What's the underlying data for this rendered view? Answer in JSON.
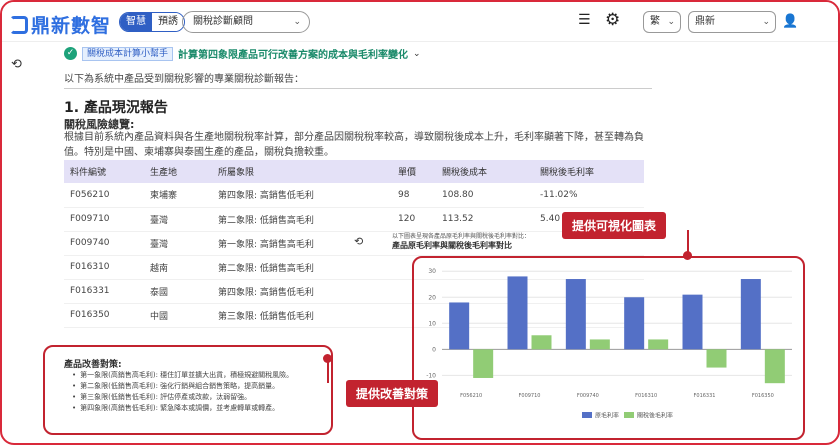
{
  "header": {
    "logo_text": "鼎新數智",
    "mode_options": [
      "智慧",
      "預誘"
    ],
    "assistant_select": "關稅診斷顧問",
    "language_select": "繁",
    "company_select": "鼎新"
  },
  "banner": {
    "tag": "關稅成本計算小幫手",
    "title": "計算第四象限產品可行改善方案的成本與毛利率變化"
  },
  "report": {
    "intro": "以下為系統中產品受到關稅影響的專業關稅診斷報告：",
    "section_title": "1. 產品現況報告",
    "risk_title": "關稅風險總覽:",
    "risk_text": "根據目前系統內產品資料與各生產地關稅稅率計算，部分產品因關稅稅率較高，導致關稅後成本上升，毛利率顯著下降，甚至轉為負值。特別是中國、柬埔寨與泰國生產的產品，關稅負擔較重。"
  },
  "table": {
    "headers": [
      "料件編號",
      "生產地",
      "所屬象限",
      "單價",
      "關稅後成本",
      "關稅後毛利率"
    ],
    "rows": [
      [
        "F056210",
        "柬埔寨",
        "第四象限: 高銷售低毛利",
        "98",
        "108.80",
        "-11.02%"
      ],
      [
        "F009710",
        "臺灣",
        "第二象限: 低銷售高毛利",
        "120",
        "113.52",
        "5.40"
      ],
      [
        "F009740",
        "臺灣",
        "第一象限: 高銷售高毛利",
        "",
        "",
        ""
      ],
      [
        "F016310",
        "越南",
        "第二象限: 低銷售高毛利",
        "",
        "",
        ""
      ],
      [
        "F016331",
        "泰國",
        "第四象限: 高銷售低毛利",
        "",
        "",
        ""
      ],
      [
        "F016350",
        "中國",
        "第三象限: 低銷售低毛利",
        "",
        "",
        ""
      ]
    ]
  },
  "chart_caption": "以下圖表呈現各產品原毛利率與關稅後毛利率對比：",
  "chart_data": {
    "type": "bar",
    "title": "產品原毛利率與關稅後毛利率對比",
    "categories": [
      "F056210",
      "F009710",
      "F009740",
      "F016310",
      "F016331",
      "F016350"
    ],
    "series": [
      {
        "name": "原毛利率",
        "values": [
          18,
          28,
          27,
          20,
          21,
          27
        ],
        "color": "#5470c6"
      },
      {
        "name": "關稅後毛利率",
        "values": [
          -11,
          5.4,
          3.8,
          3.8,
          -7,
          -13
        ],
        "color": "#91cc75"
      }
    ],
    "yticks": [
      -10,
      0,
      10,
      20,
      30
    ],
    "ylim": [
      -16,
      32
    ],
    "grid": true,
    "legend": "bottom-center"
  },
  "callouts": {
    "chart": "提供可視化圖表",
    "strategy": "提供改善對策"
  },
  "strategy": {
    "title": "產品改善對策:",
    "items": [
      "第一象限(高銷售高毛利): 穩住訂單並擴大出貨，積極規避關稅風險。",
      "第二象限(低銷售高毛利): 強化行銷與組合銷售策略，提高銷量。",
      "第三象限(低銷售低毛利): 評估停產或改款，汰弱留強。",
      "第四象限(高銷售低毛利): 緊急降本或調價，並考慮轉單或轉產。"
    ]
  }
}
